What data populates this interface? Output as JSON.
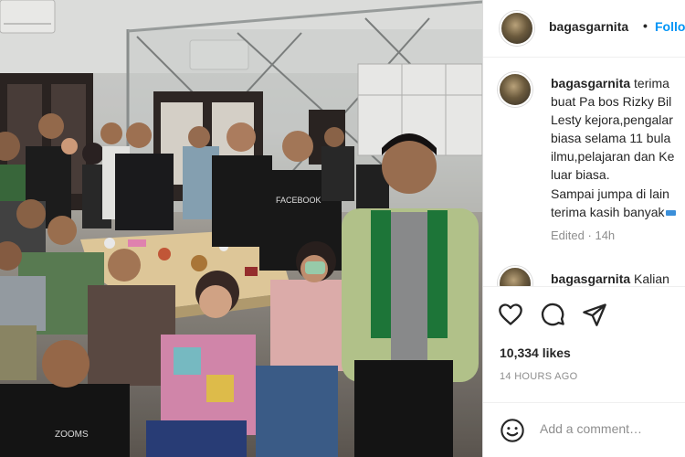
{
  "post": {
    "username": "bagasgarnita",
    "separator": "•",
    "follow_label": "Follo",
    "caption_lines": [
      "terima",
      "buat Pa bos Rizky Bil",
      "Lesty kejora,pengalar",
      "biasa selama 11 bula",
      "ilmu,pelajaran dan Ke",
      "luar biasa.",
      "Sampai jumpa di lain",
      "terima kasih banyak"
    ],
    "edited_label": "Edited",
    "edited_separator": "·",
    "edited_time": "14h",
    "second_comment": {
      "username": "bagasgarnita",
      "text": "Kalian"
    },
    "likes": "10,334 likes",
    "timestamp": "14 HOURS AGO",
    "comment_placeholder": "Add a comment…"
  },
  "photo": {
    "shirt_texts": [
      "FACEBOOK",
      "ZOOMS"
    ]
  },
  "icons": {
    "like": "heart-icon",
    "comment": "comment-icon",
    "share": "paper-plane-icon",
    "emoji": "smiley-icon"
  },
  "colors": {
    "link_blue": "#0095f6",
    "text": "#262626",
    "muted": "#8e8e8e",
    "border": "#dbdbdb"
  }
}
